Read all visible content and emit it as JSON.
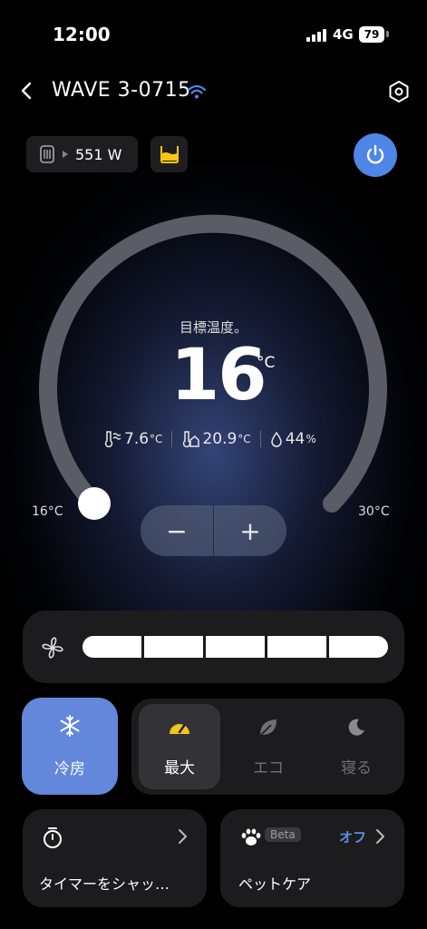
{
  "status_bar": {
    "time": "12:00",
    "network": "4G",
    "battery": "79"
  },
  "header": {
    "title": "WAVE 3-0715",
    "back_icon": "chevron-left-icon",
    "wifi_icon": "wifi-icon",
    "settings_icon": "hexagon-gear-icon"
  },
  "power_chip": {
    "watts": "551 W",
    "icon": "ac-unit-icon"
  },
  "tank_chip": {
    "icon": "water-tank-icon",
    "accent": "#f5c518"
  },
  "power_button": {
    "icon": "power-icon",
    "color": "#4f86e6"
  },
  "dial": {
    "label": "目標温度。",
    "value": "16",
    "unit": "°C",
    "min_label": "16°C",
    "max_label": "30°C",
    "minus": "−",
    "plus": "+",
    "readings": {
      "outdoor": "7.6",
      "outdoor_unit": "°C",
      "indoor": "20.9",
      "indoor_unit": "°C",
      "humidity": "44",
      "humidity_unit": "%"
    }
  },
  "fan": {
    "icon": "fan-icon",
    "level": 5,
    "max_level": 5
  },
  "modes": {
    "cool": {
      "label": "冷房",
      "icon": "snowflake-icon",
      "color": "#6287db"
    },
    "items": [
      {
        "label": "最大",
        "icon": "speedometer-icon",
        "selected": true
      },
      {
        "label": "エコ",
        "icon": "leaf-icon",
        "selected": false
      },
      {
        "label": "寝る",
        "icon": "moon-icon",
        "selected": false
      }
    ]
  },
  "timer_card": {
    "label": "タイマーをシャッ…",
    "icon": "stopwatch-icon"
  },
  "pet_card": {
    "label": "ペットケア",
    "badge": "Beta",
    "state": "オフ",
    "icon": "paw-icon"
  }
}
